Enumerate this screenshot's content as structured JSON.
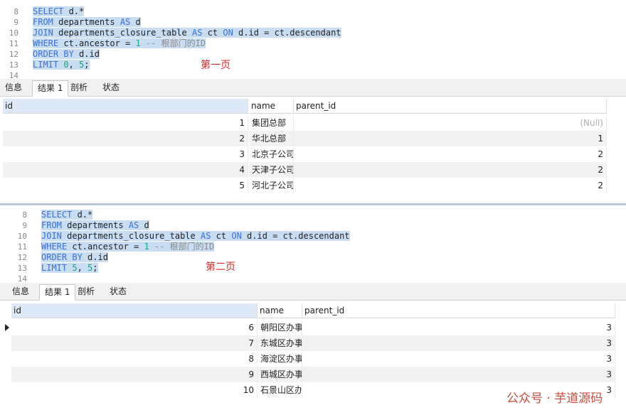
{
  "panels": [
    {
      "lines": [
        {
          "n": "8",
          "parts": [
            {
              "t": "SELECT",
              "c": "kw"
            },
            {
              "t": " d.*",
              "c": "plain"
            }
          ]
        },
        {
          "n": "9",
          "parts": [
            {
              "t": "FROM",
              "c": "kw"
            },
            {
              "t": " departments ",
              "c": "plain"
            },
            {
              "t": "AS",
              "c": "kw"
            },
            {
              "t": " d",
              "c": "plain"
            }
          ]
        },
        {
          "n": "10",
          "parts": [
            {
              "t": "JOIN",
              "c": "kw"
            },
            {
              "t": " departments_closure_table ",
              "c": "plain"
            },
            {
              "t": "AS",
              "c": "kw"
            },
            {
              "t": " ct ",
              "c": "plain"
            },
            {
              "t": "ON",
              "c": "kw"
            },
            {
              "t": " d.id = ct.descendant",
              "c": "plain"
            }
          ]
        },
        {
          "n": "11",
          "parts": [
            {
              "t": "WHERE",
              "c": "kw"
            },
            {
              "t": " ct.ancestor = ",
              "c": "plain"
            },
            {
              "t": "1",
              "c": "num"
            },
            {
              "t": " -- 根部门的ID",
              "c": "cm"
            }
          ]
        },
        {
          "n": "12",
          "parts": [
            {
              "t": "ORDER BY",
              "c": "kw"
            },
            {
              "t": " d.id",
              "c": "plain"
            }
          ]
        },
        {
          "n": "13",
          "parts": [
            {
              "t": "LIMIT",
              "c": "kw"
            },
            {
              "t": " ",
              "c": "plain"
            },
            {
              "t": "0",
              "c": "num"
            },
            {
              "t": ", ",
              "c": "plain"
            },
            {
              "t": "5",
              "c": "num"
            },
            {
              "t": ";",
              "c": "plain"
            }
          ]
        },
        {
          "n": "14",
          "parts": []
        }
      ],
      "page_label": "第一页",
      "tabs": [
        "信息",
        "结果 1",
        "剖析",
        "状态"
      ],
      "active_tab": 1,
      "columns": [
        "id",
        "name",
        "parent_id"
      ],
      "rows": [
        {
          "id": "1",
          "name": "集团总部",
          "parent_id": "(Null)"
        },
        {
          "id": "2",
          "name": "华北总部",
          "parent_id": "1"
        },
        {
          "id": "3",
          "name": "北京子公司",
          "parent_id": "2"
        },
        {
          "id": "4",
          "name": "天津子公司",
          "parent_id": "2"
        },
        {
          "id": "5",
          "name": "河北子公司",
          "parent_id": "2"
        }
      ]
    },
    {
      "lines": [
        {
          "n": "8",
          "parts": [
            {
              "t": "SELECT",
              "c": "kw"
            },
            {
              "t": " d.*",
              "c": "plain"
            }
          ]
        },
        {
          "n": "9",
          "parts": [
            {
              "t": "FROM",
              "c": "kw"
            },
            {
              "t": " departments ",
              "c": "plain"
            },
            {
              "t": "AS",
              "c": "kw"
            },
            {
              "t": " d",
              "c": "plain"
            }
          ]
        },
        {
          "n": "10",
          "parts": [
            {
              "t": "JOIN",
              "c": "kw"
            },
            {
              "t": " departments_closure_table ",
              "c": "plain"
            },
            {
              "t": "AS",
              "c": "kw"
            },
            {
              "t": " ct ",
              "c": "plain"
            },
            {
              "t": "ON",
              "c": "kw"
            },
            {
              "t": " d.id = ct.descendant",
              "c": "plain"
            }
          ]
        },
        {
          "n": "11",
          "parts": [
            {
              "t": "WHERE",
              "c": "kw"
            },
            {
              "t": " ct.ancestor = ",
              "c": "plain"
            },
            {
              "t": "1",
              "c": "num"
            },
            {
              "t": " -- 根部门的ID",
              "c": "cm"
            }
          ]
        },
        {
          "n": "12",
          "parts": [
            {
              "t": "ORDER BY",
              "c": "kw"
            },
            {
              "t": " d.id",
              "c": "plain"
            }
          ]
        },
        {
          "n": "13",
          "parts": [
            {
              "t": "LIMIT",
              "c": "kw"
            },
            {
              "t": " ",
              "c": "plain"
            },
            {
              "t": "5",
              "c": "num"
            },
            {
              "t": ", ",
              "c": "plain"
            },
            {
              "t": "5",
              "c": "num"
            },
            {
              "t": ";",
              "c": "plain"
            }
          ]
        },
        {
          "n": "14",
          "parts": []
        }
      ],
      "page_label": "第二页",
      "tabs": [
        "信息",
        "结果 1",
        "剖析",
        "状态"
      ],
      "active_tab": 1,
      "columns": [
        "id",
        "name",
        "parent_id"
      ],
      "rows": [
        {
          "id": "6",
          "name": "朝阳区办事",
          "parent_id": "3"
        },
        {
          "id": "7",
          "name": "东城区办事",
          "parent_id": "3"
        },
        {
          "id": "8",
          "name": "海淀区办事",
          "parent_id": "3"
        },
        {
          "id": "9",
          "name": "西城区办事",
          "parent_id": "3"
        },
        {
          "id": "10",
          "name": "石景山区办",
          "parent_id": "3"
        }
      ]
    }
  ],
  "watermark": "公众号 · 芋道源码",
  "colors": {
    "keyword": "#3a6fd8",
    "number": "#1aa37a",
    "comment": "#8a8a8a",
    "selection": "#c9ddf2",
    "page_label": "#d22a2a"
  }
}
